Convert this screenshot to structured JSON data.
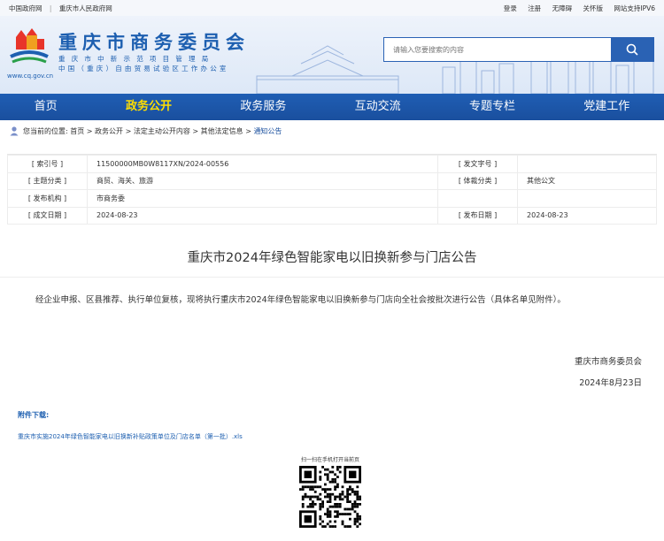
{
  "topbar": {
    "links_left": [
      "中国政府网",
      "重庆市人民政府网"
    ],
    "sep": "|",
    "links_right": [
      "登录",
      "注册",
      "无障碍",
      "关怀版",
      "网站支持IPV6"
    ]
  },
  "header": {
    "title": "重庆市商务委员会",
    "sub1": "重庆市中新示范项目管理局",
    "sub2": "中国（重庆）自由贸易试验区工作办公室",
    "url": "www.cq.gov.cn",
    "search_placeholder": "请输入您要搜索的内容"
  },
  "nav": [
    "首页",
    "政务公开",
    "政务服务",
    "互动交流",
    "专题专栏",
    "党建工作"
  ],
  "nav_active": 1,
  "breadcrumb": {
    "label": "您当前的位置:",
    "items": [
      "首页",
      "政务公开",
      "法定主动公开内容",
      "其他法定信息"
    ],
    "current": "通知公告",
    "sep": ">"
  },
  "meta": {
    "rows": [
      {
        "k1": "[ 索引号 ]",
        "v1": "11500000MB0W8117XN/2024-00556",
        "k2": "[ 发文字号 ]",
        "v2": ""
      },
      {
        "k1": "[ 主题分类 ]",
        "v1": "商贸、海关、旅游",
        "k2": "[ 体裁分类 ]",
        "v2": "其他公文"
      },
      {
        "k1": "[ 发布机构 ]",
        "v1": "市商务委",
        "k2": "",
        "v2": ""
      },
      {
        "k1": "[ 成文日期 ]",
        "v1": "2024-08-23",
        "k2": "[ 发布日期 ]",
        "v2": "2024-08-23"
      }
    ]
  },
  "article": {
    "title": "重庆市2024年绿色智能家电以旧换新参与门店公告",
    "body": "经企业申报、区县推荐、执行单位复核，现将执行重庆市2024年绿色智能家电以旧换新参与门店向全社会按批次进行公告（具体名单见附件）。",
    "signer": "重庆市商务委员会",
    "date": "2024年8月23日"
  },
  "attachment": {
    "label": "附件下载:",
    "file": "重庆市实施2024年绿色智能家电以旧换新补贴政策单位及门店名单（第一批）.xls"
  },
  "qr": {
    "caption": "扫一扫在手机打开当前页"
  },
  "colors": {
    "brand_blue": "#1d5fb0",
    "nav_bg": "#1f5eb4",
    "nav_active": "#ffde00"
  }
}
